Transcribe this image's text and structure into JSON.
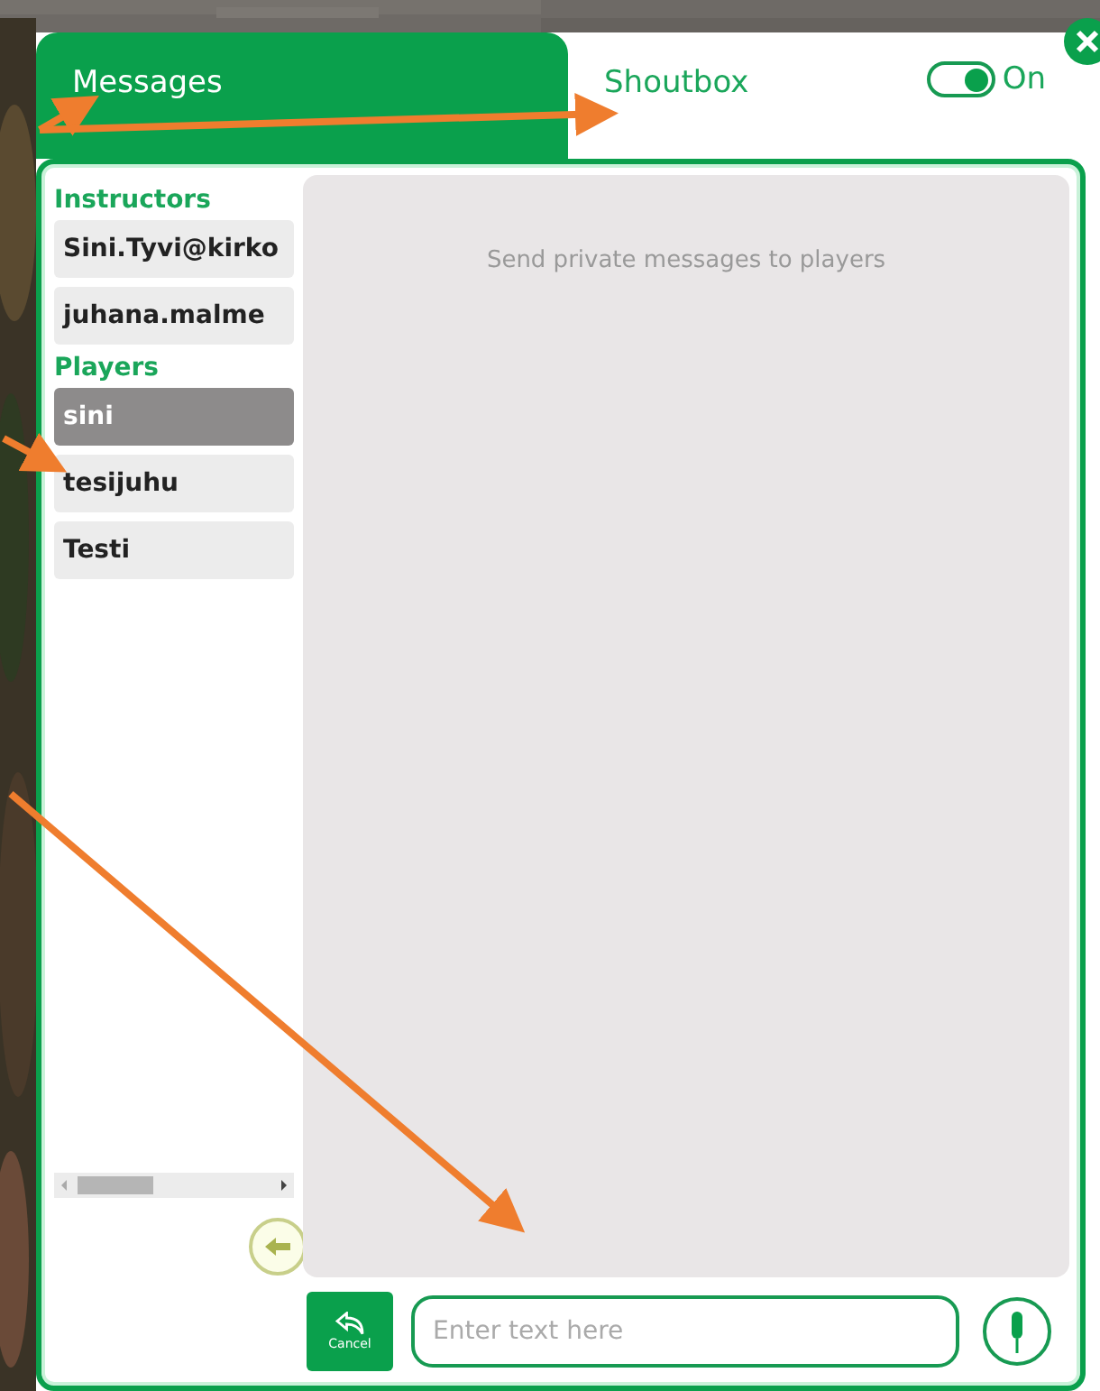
{
  "tabs": [
    {
      "label": "Messages",
      "selected": true
    },
    {
      "label": "Shoutbox",
      "selected": false
    }
  ],
  "toggle": {
    "label": "On",
    "on": true
  },
  "groups": [
    {
      "title": "Instructors",
      "items": [
        {
          "label": "Sini.Tyvi@kirko",
          "selected": false
        },
        {
          "label": "juhana.malme",
          "selected": false
        }
      ]
    },
    {
      "title": "Players",
      "items": [
        {
          "label": "sini",
          "selected": true
        },
        {
          "label": "tesijuhu",
          "selected": false
        },
        {
          "label": "Testi",
          "selected": false
        }
      ]
    }
  ],
  "panel": {
    "hint": "Send private messages to players"
  },
  "cancel": {
    "label": "Cancel"
  },
  "input": {
    "placeholder": "Enter text here"
  }
}
